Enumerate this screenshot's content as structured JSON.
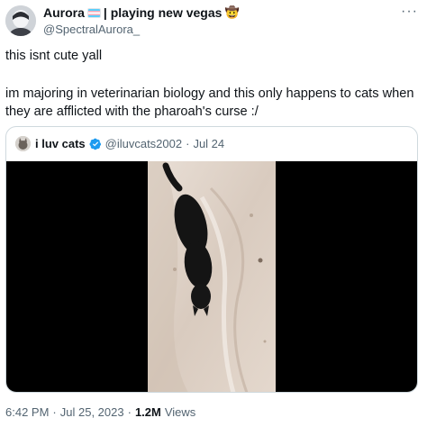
{
  "author": {
    "name": "Aurora",
    "name_suffix": "| playing new vegas",
    "handle": "@SpectralAurora_",
    "flag_icon": "transgender-flag-emoji",
    "hat_icon": "cowboy-hat-face-emoji"
  },
  "tweet": {
    "line1": "this isnt cute yall",
    "line2": "im majoring in veterinarian biology and this only happens to cats when",
    "line3": "they are afflicted with the pharoah's curse :/"
  },
  "quoted": {
    "name": "i luv cats",
    "handle": "@iluvcats2002",
    "separator": "·",
    "date": "Jul 24",
    "verified_icon": "verified-badge-icon"
  },
  "footer": {
    "time": "6:42 PM",
    "sep1": "·",
    "date": "Jul 25, 2023",
    "sep2": "·",
    "views_count": "1.2M",
    "views_label": "Views"
  },
  "colors": {
    "text": "#0f1419",
    "secondary": "#536471",
    "border": "#cfd9de",
    "verified": "#1d9bf0"
  }
}
